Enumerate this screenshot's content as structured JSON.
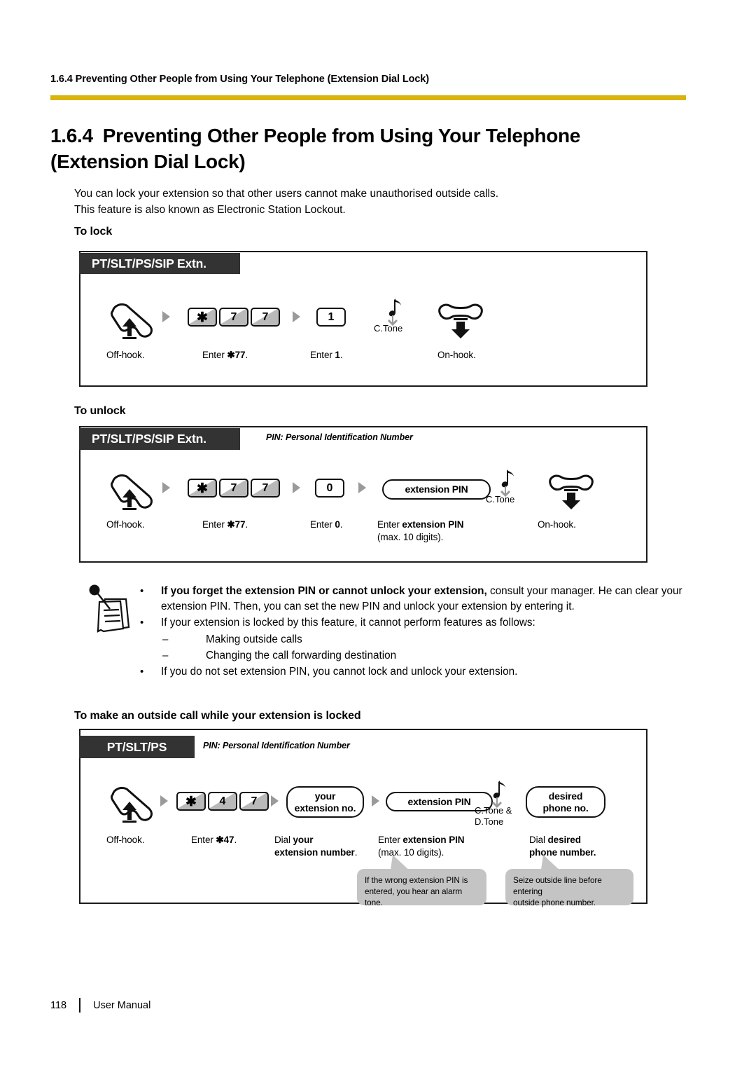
{
  "document": {
    "running_head": "1.6.4 Preventing Other People from Using Your Telephone (Extension Dial Lock)",
    "accent_color": "#d9b40c",
    "title_number": "1.6.4",
    "title_text": "Preventing Other People from Using Your Telephone (Extension Dial Lock)",
    "intro_line1": "You can lock your extension so that other users cannot make unauthorised outside calls.",
    "intro_line2": "This feature is also known as Electronic Station Lockout."
  },
  "sections": {
    "to_lock": "To lock",
    "to_unlock": "To unlock",
    "to_make_outside_call": "To make an outside call while your extension is locked"
  },
  "diagram_lock": {
    "tag": "PT/SLT/PS/SIP Extn.",
    "steps": [
      {
        "icon": "offhook-handset-icon",
        "caption": "Off-hook."
      },
      {
        "keys": [
          "✱",
          "7",
          "7"
        ],
        "caption_prefix": "Enter ",
        "caption_bold": "✱77",
        "caption_suffix": "."
      },
      {
        "keys": [
          "1"
        ],
        "caption_prefix": "Enter ",
        "caption_bold": "1",
        "caption_suffix": "."
      },
      {
        "tone": "C.Tone"
      },
      {
        "icon": "onhook-handset-icon",
        "caption": "On-hook."
      }
    ]
  },
  "diagram_unlock": {
    "tag": "PT/SLT/PS/SIP Extn.",
    "pin_note": "PIN: Personal Identification Number",
    "steps": [
      {
        "icon": "offhook-handset-icon",
        "caption": "Off-hook."
      },
      {
        "keys": [
          "✱",
          "7",
          "7"
        ],
        "caption_prefix": "Enter ",
        "caption_bold": "✱77",
        "caption_suffix": "."
      },
      {
        "keys": [
          "0"
        ],
        "caption_prefix": "Enter ",
        "caption_bold": "0",
        "caption_suffix": "."
      },
      {
        "pill": "extension PIN",
        "caption_prefix": "Enter ",
        "caption_bold": "extension PIN",
        "caption_line2": "(max. 10 digits)."
      },
      {
        "tone": "C.Tone"
      },
      {
        "icon": "onhook-handset-icon",
        "caption": "On-hook."
      }
    ]
  },
  "diagram_outside_call": {
    "tag": "PT/SLT/PS",
    "pin_note": "PIN: Personal Identification Number",
    "steps": [
      {
        "icon": "offhook-handset-icon",
        "caption": "Off-hook."
      },
      {
        "keys": [
          "✱",
          "4",
          "7"
        ],
        "caption_prefix": "Enter ",
        "caption_bold": "✱47",
        "caption_suffix": "."
      },
      {
        "pill_line1": "your",
        "pill_line2": "extension no.",
        "caption_prefix": "Dial ",
        "caption_bold": "your",
        "caption_line2_bold": "extension number",
        "caption_line2_suffix": "."
      },
      {
        "pill": "extension PIN",
        "caption_prefix": "Enter ",
        "caption_bold": "extension PIN",
        "caption_line2": "(max. 10 digits)."
      },
      {
        "tone_line1": "C.Tone &",
        "tone_line2": "D.Tone"
      },
      {
        "pill_line1": "desired",
        "pill_line2": "phone no.",
        "caption_prefix": "Dial ",
        "caption_bold": "desired",
        "caption_line2_bold": "phone number."
      }
    ],
    "callouts": [
      {
        "line1": "If the wrong extension PIN is",
        "line2": "entered, you hear an alarm tone."
      },
      {
        "line1": "Seize outside line before entering",
        "line2": "outside phone number."
      }
    ]
  },
  "notes": {
    "icon": "memo-note-icon",
    "items": [
      {
        "bullet": "•",
        "bold": "If you forget the extension PIN or cannot unlock your extension,",
        "rest": " consult your manager. He can clear your extension PIN. Then, you can set the new PIN and unlock your extension by entering it."
      },
      {
        "bullet": "•",
        "bold": "",
        "rest": "If your extension is locked by this feature, it cannot perform features as follows:"
      },
      {
        "bullet": "–",
        "bold": "",
        "rest": "Making outside calls",
        "indent": true
      },
      {
        "bullet": "–",
        "bold": "",
        "rest": "Changing the call forwarding destination",
        "indent": true
      },
      {
        "bullet": "•",
        "bold": "",
        "rest": "If you do not set extension PIN, you cannot lock and unlock your extension."
      }
    ]
  },
  "footer": {
    "page_number": "118",
    "label": "User Manual"
  }
}
